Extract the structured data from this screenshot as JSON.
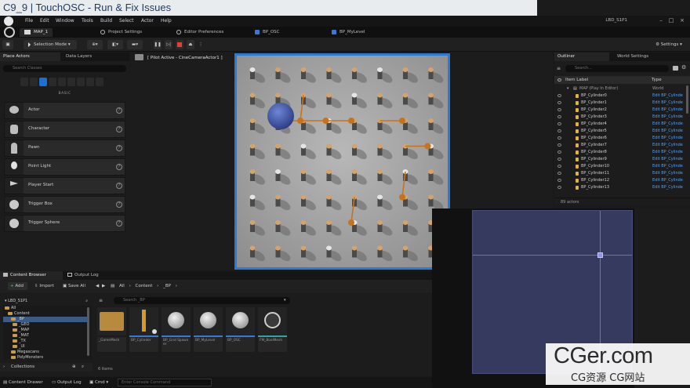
{
  "title_strip": "C9_9 | TouchOSC - Run & Fix Issues",
  "menubar": {
    "items": [
      "File",
      "Edit",
      "Window",
      "Tools",
      "Build",
      "Select",
      "Actor",
      "Help"
    ],
    "project": "LBD_S1P1"
  },
  "tabs": {
    "level": "MAP_1",
    "project_settings": "Project Settings",
    "editor_prefs": "Editor Preferences",
    "bp_osc": "BP_OSC",
    "bp_mylevel": "BP_MyLevel"
  },
  "toolbar": {
    "selection_mode": "Selection Mode",
    "settings": "Settings"
  },
  "place_actors": {
    "tab_place": "Place Actors",
    "tab_data": "Data Layers",
    "search_placeholder": "Search Classes",
    "category": "BASIC",
    "items": [
      "Actor",
      "Character",
      "Pawn",
      "Point Light",
      "Player Start",
      "Trigger Box",
      "Trigger Sphere"
    ]
  },
  "viewport": {
    "label": "[ Pilot Active - CineCameraActor1 ]"
  },
  "outliner": {
    "tab_outliner": "Outliner",
    "tab_world": "World Settings",
    "search_placeholder": "Search...",
    "col_label": "Item Label",
    "col_type": "Type",
    "map_row": {
      "label": "MAP (Play In Editor)",
      "type": "World"
    },
    "rows": [
      "BP_Cylinder0",
      "BP_Cylinder1",
      "BP_Cylinder2",
      "BP_Cylinder3",
      "BP_Cylinder4",
      "BP_Cylinder5",
      "BP_Cylinder6",
      "BP_Cylinder7",
      "BP_Cylinder8",
      "BP_Cylinder9",
      "BP_Cylinder10",
      "BP_Cylinder11",
      "BP_Cylinder12",
      "BP_Cylinder13"
    ],
    "row_type": "Edit BP_Cylinde",
    "footer": "89 actors"
  },
  "content_browser": {
    "tab_cb": "Content Browser",
    "tab_log": "Output Log",
    "add": "Add",
    "import": "Import",
    "save_all": "Save All",
    "path": [
      "All",
      "Content",
      "_BP"
    ],
    "project_root": "LBD_S1P1",
    "search_placeholder": "Search _BP",
    "tree": [
      "All",
      "Content",
      "_BP",
      "_GEO",
      "_MAP",
      "_MAT",
      "_TX",
      "_UI",
      "Megascans",
      "PolyMonsters"
    ],
    "assets": [
      {
        "label": "_GameMesh",
        "bar": "#1c1c1c"
      },
      {
        "label": "BP_Cylinder",
        "bar": "#3a78d6"
      },
      {
        "label": "BP_Grid Spawner",
        "bar": "#3a78d6"
      },
      {
        "label": "BP_MyLevel",
        "bar": "#3a78d6"
      },
      {
        "label": "BP_OSC",
        "bar": "#3a78d6"
      },
      {
        "label": "FM_BoolMesh",
        "bar": "#2ea6a6"
      }
    ],
    "count": "6 items",
    "collections": "Collections"
  },
  "statusbar": {
    "content_drawer": "Content Drawer",
    "output_log": "Output Log",
    "cmd": "Cmd",
    "console_placeholder": "Enter Console Command"
  },
  "watermark": {
    "main": "CGer.com",
    "sub": "CG资源 CG网站"
  }
}
